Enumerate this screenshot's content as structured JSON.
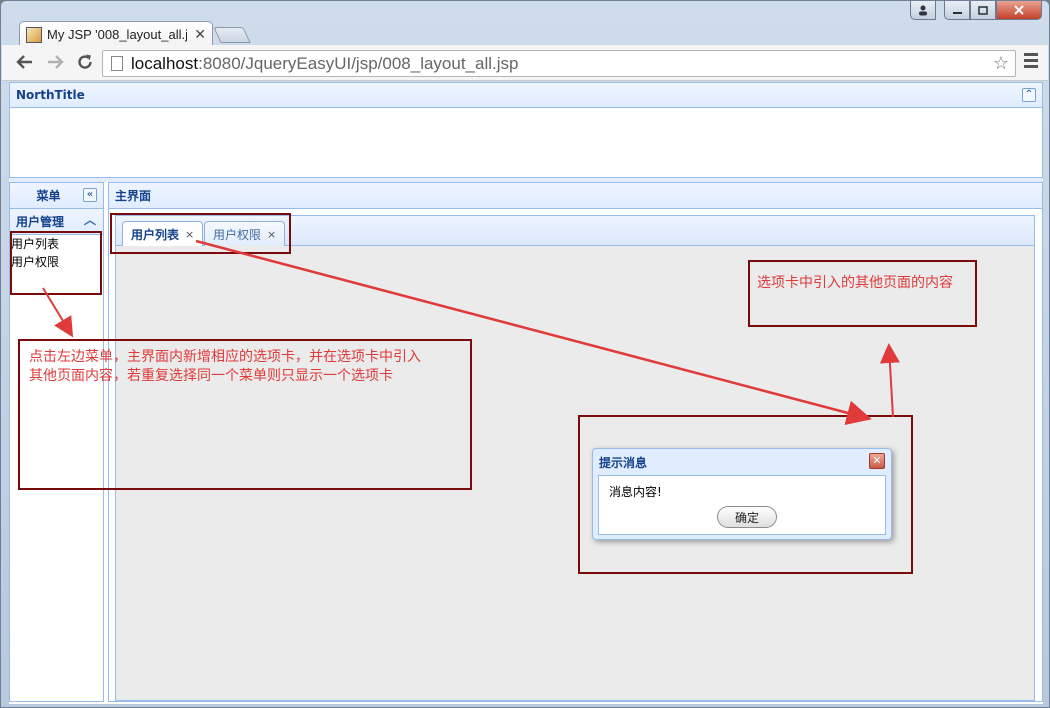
{
  "browser": {
    "tab_title": "My JSP '008_layout_all.js",
    "tab_close": "✕",
    "url_host": "localhost",
    "url_rest": ":8080/JqueryEasyUI/jsp/008_layout_all.jsp"
  },
  "layout": {
    "north_title": "NorthTitle",
    "west_title": "菜单",
    "center_title": "主界面",
    "accordion_title": "用户管理",
    "menu_items": [
      "用户列表",
      "用户权限"
    ],
    "tabs": [
      {
        "label": "用户列表",
        "close": "×"
      },
      {
        "label": "用户权限",
        "close": "×"
      }
    ]
  },
  "dialog": {
    "title": "提示消息",
    "message": "消息内容!",
    "ok_label": "确定",
    "close_glyph": "✕"
  },
  "annotations": {
    "note_left_line1": "点击左边菜单，主界面内新增相应的选项卡，并在选项卡中引入",
    "note_left_line2": "其他页面内容，若重复选择同一个菜单则只显示一个选项卡",
    "note_right": "选项卡中引入的其他页面的内容",
    "color": "#e03a3a",
    "box_color": "#7a0b0b"
  }
}
